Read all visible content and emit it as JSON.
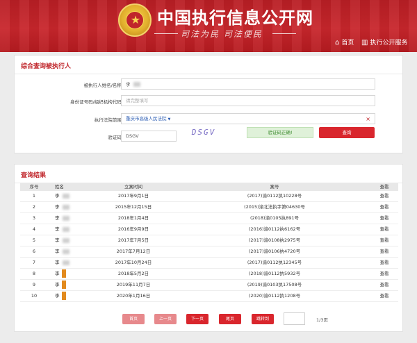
{
  "header": {
    "site_title": "中国执行信息公开网",
    "slogan": "司法为民 司法便民",
    "nav": [
      {
        "icon": "home-icon",
        "label": "首页"
      },
      {
        "icon": "building-icon",
        "label": "执行公开服务"
      }
    ]
  },
  "query_panel": {
    "title": "综合查询被执行人",
    "name_label": "被执行人姓名/名称:",
    "name_value": "李",
    "id_label": "身份证号码/组织机构代码:",
    "id_placeholder": "请完整填写",
    "court_label": "执行法院范围:",
    "court_value": "重庆市高级人民法院",
    "captcha_label": "验证码:",
    "captcha_input": "DSGV",
    "captcha_image": "DSGV",
    "verified_label": "验证码正确!",
    "query_button": "查询"
  },
  "results_panel": {
    "title": "查询结果",
    "columns": [
      "序号",
      "姓名",
      "立案时间",
      "案号",
      "查看"
    ],
    "rows": [
      {
        "no": "1",
        "name": "李",
        "date": "2017年9月1日",
        "case": "(2017)渝0112执10228号",
        "view": "查看"
      },
      {
        "no": "2",
        "name": "李",
        "date": "2015年12月15日",
        "case": "(2015)渝北法执字第04630号",
        "view": "查看"
      },
      {
        "no": "3",
        "name": "李",
        "date": "2018年1月4日",
        "case": "(2018)渝0105执891号",
        "view": "查看"
      },
      {
        "no": "4",
        "name": "李",
        "date": "2016年9月9日",
        "case": "(2016)渝0112执6162号",
        "view": "查看"
      },
      {
        "no": "5",
        "name": "李",
        "date": "2017年7月5日",
        "case": "(2017)渝0108执2975号",
        "view": "查看"
      },
      {
        "no": "6",
        "name": "李",
        "date": "2017年7月12日",
        "case": "(2017)渝0106执4720号",
        "view": "查看"
      },
      {
        "no": "7",
        "name": "李",
        "date": "2017年10月24日",
        "case": "(2017)渝0112执12345号",
        "view": "查看"
      },
      {
        "no": "8",
        "name": "李",
        "date": "2018年5月2日",
        "case": "(2018)渝0112执5932号",
        "view": "查看"
      },
      {
        "no": "9",
        "name": "李",
        "date": "2019年11月7日",
        "case": "(2019)渝0103执17508号",
        "view": "查看"
      },
      {
        "no": "10",
        "name": "李",
        "date": "2020年1月16日",
        "case": "(2020)渝0112执1208号",
        "view": "查看"
      }
    ],
    "pagination": {
      "first": "首页",
      "prev": "上一页",
      "next": "下一页",
      "last": "尾页",
      "jump": "跳转到",
      "page_info": "1/3页"
    }
  }
}
